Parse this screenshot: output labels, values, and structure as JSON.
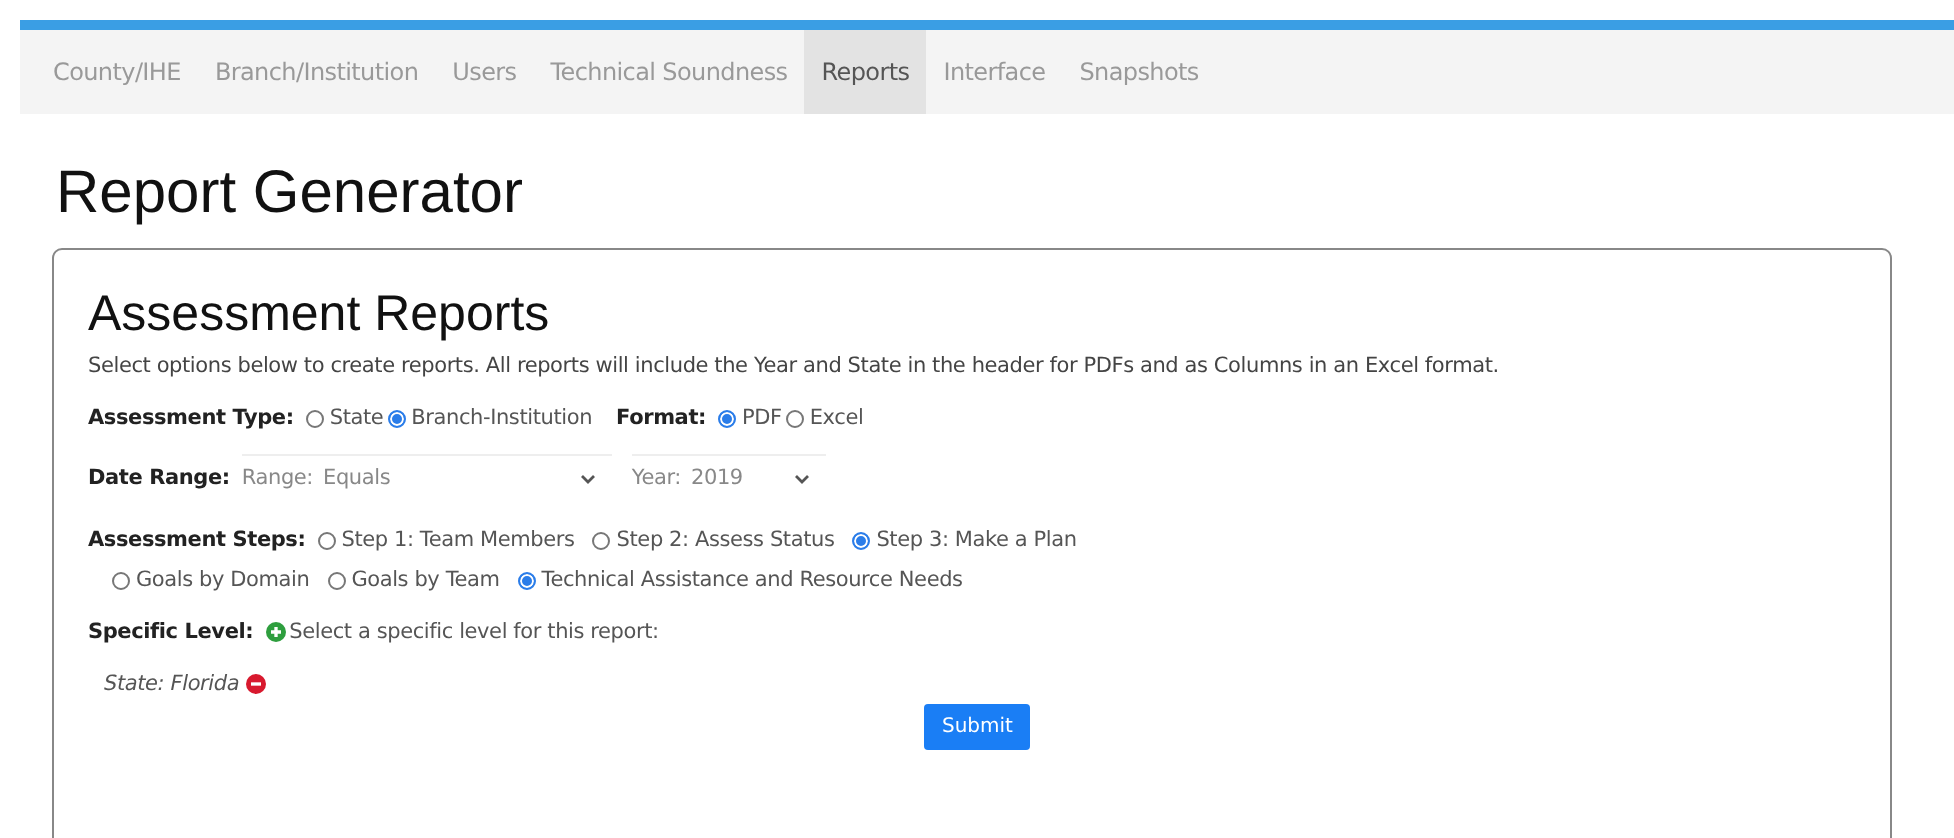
{
  "nav": [
    {
      "label": "County/IHE",
      "selected": false
    },
    {
      "label": "Branch/Institution",
      "selected": false
    },
    {
      "label": "Users",
      "selected": false
    },
    {
      "label": "Technical Soundness",
      "selected": false
    },
    {
      "label": "Reports",
      "selected": true
    },
    {
      "label": "Interface",
      "selected": false
    },
    {
      "label": "Snapshots",
      "selected": false
    }
  ],
  "page_title": "Report Generator",
  "card": {
    "title": "Assessment Reports",
    "intro": "Select options below to create reports. All reports will include the Year and State in the header for PDFs and as Columns in an Excel format.",
    "assessment_type": {
      "label": "Assessment Type:",
      "options": [
        {
          "label": "State",
          "selected": false
        },
        {
          "label": "Branch-Institution",
          "selected": true
        }
      ]
    },
    "format": {
      "label": "Format:",
      "options": [
        {
          "label": "PDF",
          "selected": true
        },
        {
          "label": "Excel",
          "selected": false
        }
      ]
    },
    "date_range": {
      "label": "Date Range:",
      "range_label": "Range:",
      "range_value": "Equals",
      "year_label": "Year:",
      "year_value": "2019"
    },
    "assessment_steps": {
      "label": "Assessment Steps:",
      "options": [
        {
          "label": "Step 1: Team Members",
          "selected": false
        },
        {
          "label": "Step 2: Assess Status",
          "selected": false
        },
        {
          "label": "Step 3: Make a Plan",
          "selected": true
        }
      ]
    },
    "plan_reports": {
      "options": [
        {
          "label": "Goals by Domain",
          "selected": false
        },
        {
          "label": "Goals by Team",
          "selected": false
        },
        {
          "label": "Technical Assistance and Resource Needs",
          "selected": true
        }
      ]
    },
    "specific_level": {
      "label": "Specific Level:",
      "prompt": "Select a specific level for this report:"
    },
    "levels": [
      "State: Florida"
    ],
    "submit": "Submit"
  }
}
